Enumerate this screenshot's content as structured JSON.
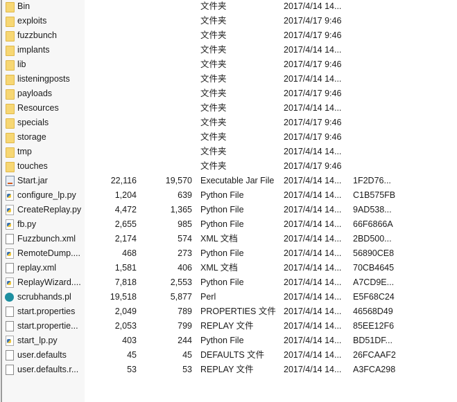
{
  "files": [
    {
      "name": "Bin",
      "compressed": "",
      "size": "",
      "type": "文件夹",
      "date": "2017/4/14 14...",
      "crc": "",
      "icon": "folder-icon"
    },
    {
      "name": "exploits",
      "compressed": "",
      "size": "",
      "type": "文件夹",
      "date": "2017/4/17 9:46",
      "crc": "",
      "icon": "folder-icon"
    },
    {
      "name": "fuzzbunch",
      "compressed": "",
      "size": "",
      "type": "文件夹",
      "date": "2017/4/17 9:46",
      "crc": "",
      "icon": "folder-icon"
    },
    {
      "name": "implants",
      "compressed": "",
      "size": "",
      "type": "文件夹",
      "date": "2017/4/14 14...",
      "crc": "",
      "icon": "folder-icon"
    },
    {
      "name": "lib",
      "compressed": "",
      "size": "",
      "type": "文件夹",
      "date": "2017/4/17 9:46",
      "crc": "",
      "icon": "folder-icon"
    },
    {
      "name": "listeningposts",
      "compressed": "",
      "size": "",
      "type": "文件夹",
      "date": "2017/4/14 14...",
      "crc": "",
      "icon": "folder-icon"
    },
    {
      "name": "payloads",
      "compressed": "",
      "size": "",
      "type": "文件夹",
      "date": "2017/4/17 9:46",
      "crc": "",
      "icon": "folder-icon"
    },
    {
      "name": "Resources",
      "compressed": "",
      "size": "",
      "type": "文件夹",
      "date": "2017/4/14 14...",
      "crc": "",
      "icon": "folder-icon"
    },
    {
      "name": "specials",
      "compressed": "",
      "size": "",
      "type": "文件夹",
      "date": "2017/4/17 9:46",
      "crc": "",
      "icon": "folder-icon"
    },
    {
      "name": "storage",
      "compressed": "",
      "size": "",
      "type": "文件夹",
      "date": "2017/4/17 9:46",
      "crc": "",
      "icon": "folder-icon"
    },
    {
      "name": "tmp",
      "compressed": "",
      "size": "",
      "type": "文件夹",
      "date": "2017/4/14 14...",
      "crc": "",
      "icon": "folder-icon"
    },
    {
      "name": "touches",
      "compressed": "",
      "size": "",
      "type": "文件夹",
      "date": "2017/4/17 9:46",
      "crc": "",
      "icon": "folder-icon"
    },
    {
      "name": "Start.jar",
      "compressed": "22,116",
      "size": "19,570",
      "type": "Executable Jar File",
      "date": "2017/4/14 14...",
      "crc": "1F2D76...",
      "icon": "jar-icon"
    },
    {
      "name": "configure_lp.py",
      "compressed": "1,204",
      "size": "639",
      "type": "Python File",
      "date": "2017/4/14 14...",
      "crc": "C1B575FB",
      "icon": "python-icon"
    },
    {
      "name": "CreateReplay.py",
      "compressed": "4,472",
      "size": "1,365",
      "type": "Python File",
      "date": "2017/4/14 14...",
      "crc": "9AD538...",
      "icon": "python-icon"
    },
    {
      "name": "fb.py",
      "compressed": "2,655",
      "size": "985",
      "type": "Python File",
      "date": "2017/4/14 14...",
      "crc": "66F6866A",
      "icon": "python-icon"
    },
    {
      "name": "Fuzzbunch.xml",
      "compressed": "2,174",
      "size": "574",
      "type": "XML 文档",
      "date": "2017/4/14 14...",
      "crc": "2BD500...",
      "icon": "file-icon"
    },
    {
      "name": "RemoteDump....",
      "compressed": "468",
      "size": "273",
      "type": "Python File",
      "date": "2017/4/14 14...",
      "crc": "56890CE8",
      "icon": "python-icon"
    },
    {
      "name": "replay.xml",
      "compressed": "1,581",
      "size": "406",
      "type": "XML 文档",
      "date": "2017/4/14 14...",
      "crc": "70CB4645",
      "icon": "file-icon"
    },
    {
      "name": "ReplayWizard....",
      "compressed": "7,818",
      "size": "2,553",
      "type": "Python File",
      "date": "2017/4/14 14...",
      "crc": "A7CD9E...",
      "icon": "python-icon"
    },
    {
      "name": "scrubhands.pl",
      "compressed": "19,518",
      "size": "5,877",
      "type": "Perl",
      "date": "2017/4/14 14...",
      "crc": "E5F68C24",
      "icon": "perl-icon"
    },
    {
      "name": "start.properties",
      "compressed": "2,049",
      "size": "789",
      "type": "PROPERTIES 文件",
      "date": "2017/4/14 14...",
      "crc": "46568D49",
      "icon": "file-icon"
    },
    {
      "name": "start.propertie...",
      "compressed": "2,053",
      "size": "799",
      "type": "REPLAY 文件",
      "date": "2017/4/14 14...",
      "crc": "85EE12F6",
      "icon": "file-icon"
    },
    {
      "name": "start_lp.py",
      "compressed": "403",
      "size": "244",
      "type": "Python File",
      "date": "2017/4/14 14...",
      "crc": "BD51DF...",
      "icon": "python-icon"
    },
    {
      "name": "user.defaults",
      "compressed": "45",
      "size": "45",
      "type": "DEFAULTS 文件",
      "date": "2017/4/14 14...",
      "crc": "26FCAAF2",
      "icon": "file-icon"
    },
    {
      "name": "user.defaults.r...",
      "compressed": "53",
      "size": "53",
      "type": "REPLAY 文件",
      "date": "2017/4/14 14...",
      "crc": "A3FCA298",
      "icon": "file-icon"
    }
  ]
}
